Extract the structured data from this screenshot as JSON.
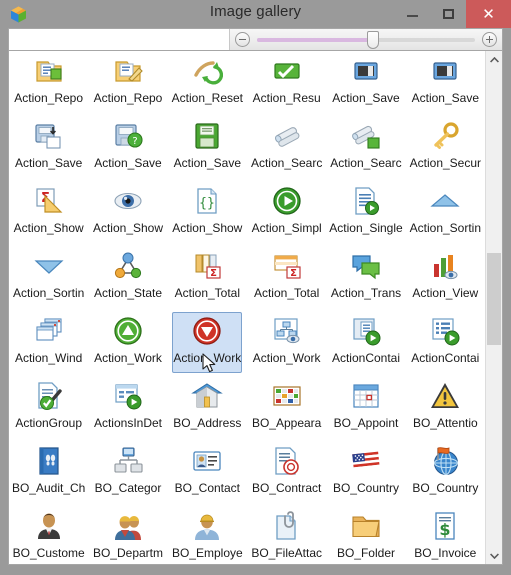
{
  "window": {
    "title": "Image gallery",
    "app_icon": "cube-logo-icon",
    "buttons": {
      "minimize_label": "–",
      "maximize_label": "❑",
      "close_label": "✕"
    }
  },
  "toolbar": {
    "search": {
      "value": "",
      "placeholder": ""
    },
    "zoom": {
      "minus_label": "−",
      "plus_label": "+",
      "value_percent": 53
    }
  },
  "scrollbar": {
    "up_arrow": "▲",
    "down_arrow": "▼",
    "thumb_top_percent": 36,
    "thumb_height_percent": 18
  },
  "gallery": {
    "columns": 6,
    "selected_index": 26,
    "items": [
      {
        "label": "Action_Repo",
        "icon": "report-export-icon"
      },
      {
        "label": "Action_Repo",
        "icon": "report-edit-icon"
      },
      {
        "label": "Action_Reset",
        "icon": "reset-refresh-icon"
      },
      {
        "label": "Action_Resu",
        "icon": "resume-green-icon"
      },
      {
        "label": "Action_Save",
        "icon": "save-blue-icon"
      },
      {
        "label": "Action_Save",
        "icon": "save-blue-icon"
      },
      {
        "label": "Action_Save",
        "icon": "save-as-icon"
      },
      {
        "label": "Action_Save",
        "icon": "save-help-icon"
      },
      {
        "label": "Action_Save",
        "icon": "save-green-icon"
      },
      {
        "label": "Action_Searc",
        "icon": "pipes-search-icon"
      },
      {
        "label": "Action_Searc",
        "icon": "pipes-green-icon"
      },
      {
        "label": "Action_Secur",
        "icon": "key-icon"
      },
      {
        "label": "Action_Show",
        "icon": "sum-triangle-icon"
      },
      {
        "label": "Action_Show",
        "icon": "eye-icon"
      },
      {
        "label": "Action_Show",
        "icon": "braces-document-icon"
      },
      {
        "label": "Action_Simpl",
        "icon": "play-circle-icon"
      },
      {
        "label": "Action_Single",
        "icon": "document-play-icon"
      },
      {
        "label": "Action_Sortin",
        "icon": "sort-ascending-icon"
      },
      {
        "label": "Action_Sortin",
        "icon": "sort-descending-icon"
      },
      {
        "label": "Action_State",
        "icon": "state-graph-icon"
      },
      {
        "label": "Action_Total",
        "icon": "columns-sum-icon"
      },
      {
        "label": "Action_Total",
        "icon": "table-sum-icon"
      },
      {
        "label": "Action_Trans",
        "icon": "chat-bubbles-icon"
      },
      {
        "label": "Action_View",
        "icon": "bar-chart-eye-icon"
      },
      {
        "label": "Action_Wind",
        "icon": "windows-stack-icon"
      },
      {
        "label": "Action_Work",
        "icon": "up-circle-green-icon"
      },
      {
        "label": "Action_Work",
        "icon": "down-circle-red-icon"
      },
      {
        "label": "Action_Work",
        "icon": "workflow-eye-icon"
      },
      {
        "label": "ActionContai",
        "icon": "container-play-icon"
      },
      {
        "label": "ActionContai",
        "icon": "container-list-play-icon"
      },
      {
        "label": "ActionGroup",
        "icon": "document-check-icon"
      },
      {
        "label": "ActionsInDet",
        "icon": "detail-play-icon"
      },
      {
        "label": "BO_Address",
        "icon": "house-icon"
      },
      {
        "label": "BO_Appeara",
        "icon": "color-grid-icon"
      },
      {
        "label": "BO_Appoint",
        "icon": "calendar-icon"
      },
      {
        "label": "BO_Attentio",
        "icon": "warning-triangle-icon"
      },
      {
        "label": "BO_Audit_Ch",
        "icon": "audit-book-icon"
      },
      {
        "label": "BO_Categor",
        "icon": "category-tree-icon"
      },
      {
        "label": "BO_Contact",
        "icon": "contact-card-icon"
      },
      {
        "label": "BO_Contract",
        "icon": "contract-seal-icon"
      },
      {
        "label": "BO_Country",
        "icon": "usa-flag-icon"
      },
      {
        "label": "BO_Country",
        "icon": "globe-flag-icon"
      },
      {
        "label": "BO_Custome",
        "icon": "businessman-icon"
      },
      {
        "label": "BO_Departm",
        "icon": "workers-group-icon"
      },
      {
        "label": "BO_Employe",
        "icon": "worker-icon"
      },
      {
        "label": "BO_FileAttac",
        "icon": "paperclip-document-icon"
      },
      {
        "label": "BO_Folder",
        "icon": "folder-icon"
      },
      {
        "label": "BO_Invoice",
        "icon": "invoice-dollar-icon"
      }
    ]
  },
  "colors": {
    "window_chrome": "#9a9a9a",
    "close_button": "#cc5a5a",
    "selection_fill": "#cfe0f5",
    "selection_border": "#7da2ce",
    "slider_fill": "#d9b8e0"
  }
}
